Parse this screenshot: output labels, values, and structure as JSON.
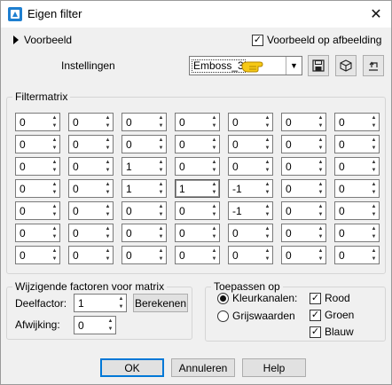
{
  "window": {
    "title": "Eigen filter"
  },
  "preview": {
    "expander_label": "Voorbeeld",
    "image_preview_label": "Voorbeeld op afbeelding",
    "image_preview_checked": true
  },
  "settings": {
    "label": "Instellingen",
    "preset_value": "Emboss_3"
  },
  "filtermatrix": {
    "title": "Filtermatrix",
    "rows": [
      [
        "0",
        "0",
        "0",
        "0",
        "0",
        "0",
        "0"
      ],
      [
        "0",
        "0",
        "0",
        "0",
        "0",
        "0",
        "0"
      ],
      [
        "0",
        "0",
        "1",
        "0",
        "0",
        "0",
        "0"
      ],
      [
        "0",
        "0",
        "1",
        "1",
        "-1",
        "0",
        "0"
      ],
      [
        "0",
        "0",
        "0",
        "0",
        "-1",
        "0",
        "0"
      ],
      [
        "0",
        "0",
        "0",
        "0",
        "0",
        "0",
        "0"
      ],
      [
        "0",
        "0",
        "0",
        "0",
        "0",
        "0",
        "0"
      ]
    ]
  },
  "factors": {
    "title": "Wijzigende factoren voor matrix",
    "divisor_label": "Deelfactor:",
    "divisor_value": "1",
    "calculate_label": "Berekenen",
    "bias_label": "Afwijking:",
    "bias_value": "0"
  },
  "apply": {
    "title": "Toepassen op",
    "color_channels_label": "Kleurkanalen:",
    "grayscale_label": "Grijswaarden",
    "red_label": "Rood",
    "green_label": "Groen",
    "blue_label": "Blauw"
  },
  "buttons": {
    "ok": "OK",
    "cancel": "Annuleren",
    "help": "Help"
  }
}
